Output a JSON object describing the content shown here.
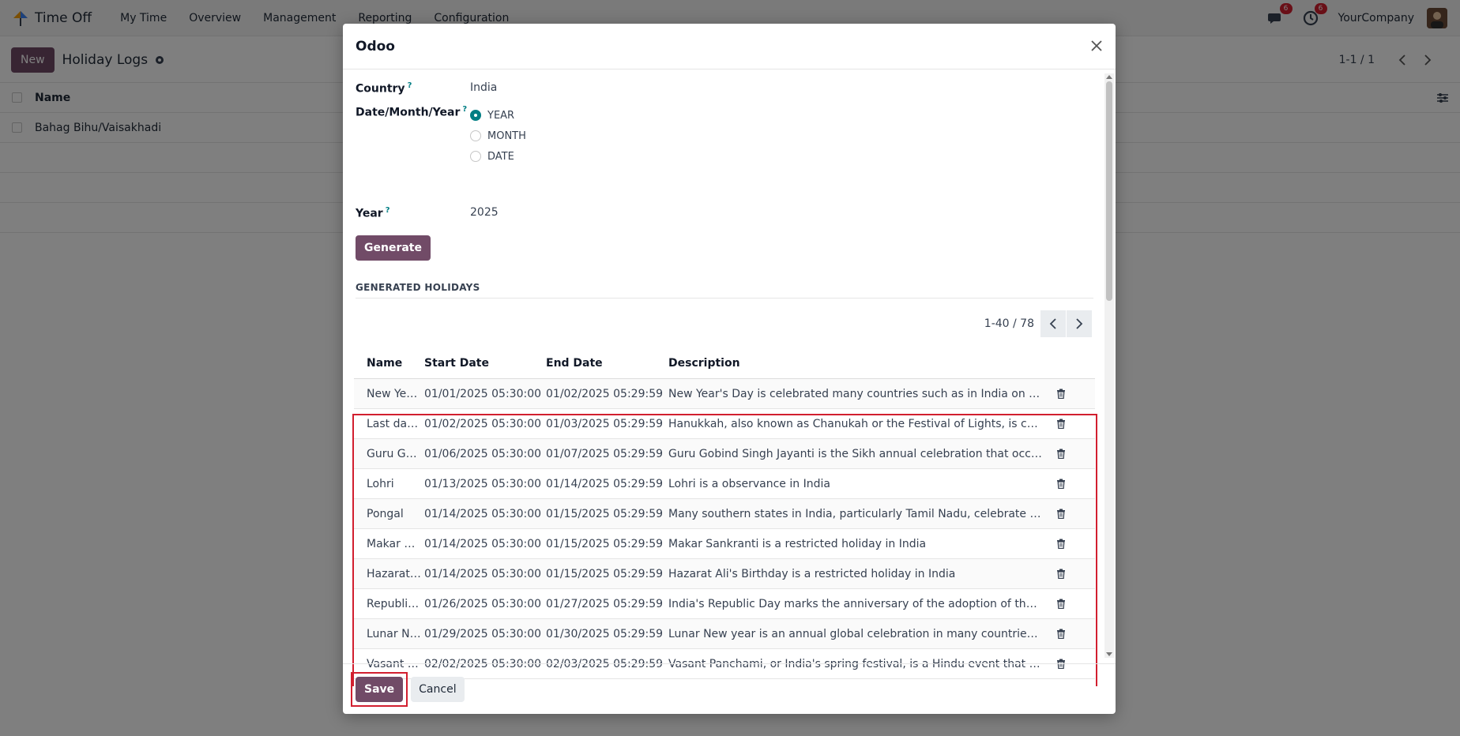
{
  "navbar": {
    "app_name": "Time Off",
    "menu": [
      "My Time",
      "Overview",
      "Management",
      "Reporting",
      "Configuration"
    ],
    "chat_badge": "6",
    "activity_badge": "6",
    "company": "YourCompany"
  },
  "control": {
    "new_label": "New",
    "title": "Holiday Logs",
    "pager": "1-1 / 1"
  },
  "list": {
    "header": "Name",
    "rows": [
      "Bahag Bihu/Vaisakhadi"
    ]
  },
  "modal": {
    "title": "Odoo",
    "country_label": "Country",
    "country_value": "India",
    "period_label": "Date/Month/Year",
    "period_options": [
      "YEAR",
      "MONTH",
      "DATE"
    ],
    "period_selected": "YEAR",
    "year_label": "Year",
    "year_value": "2025",
    "generate_label": "Generate",
    "section_title": "GENERATED HOLIDAYS",
    "pager": "1-40 / 78",
    "columns": [
      "Name",
      "Start Date",
      "End Date",
      "Description"
    ],
    "holidays": [
      {
        "name": "New Year'...",
        "start": "01/01/2025 05:30:00",
        "end": "01/02/2025 05:29:59",
        "desc": "New Year's Day is celebrated many countries such as in India on the Janua..."
      },
      {
        "name": "Last day o...",
        "start": "01/02/2025 05:30:00",
        "end": "01/03/2025 05:29:59",
        "desc": "Hanukkah, also known as Chanukah or the Festival of Lights, is celebrated..."
      },
      {
        "name": "Guru Govi...",
        "start": "01/06/2025 05:30:00",
        "end": "01/07/2025 05:29:59",
        "desc": "Guru Gobind Singh Jayanti is the Sikh annual celebration that occurs in co..."
      },
      {
        "name": "Lohri",
        "start": "01/13/2025 05:30:00",
        "end": "01/14/2025 05:29:59",
        "desc": "Lohri is a observance in India"
      },
      {
        "name": "Pongal",
        "start": "01/14/2025 05:30:00",
        "end": "01/15/2025 05:29:59",
        "desc": "Many southern states in India, particularly Tamil Nadu, celebrate Pongal a..."
      },
      {
        "name": "Makar San...",
        "start": "01/14/2025 05:30:00",
        "end": "01/15/2025 05:29:59",
        "desc": "Makar Sankranti is a restricted holiday in India"
      },
      {
        "name": "Hazarat A...",
        "start": "01/14/2025 05:30:00",
        "end": "01/15/2025 05:29:59",
        "desc": "Hazarat Ali's Birthday is a restricted holiday in India"
      },
      {
        "name": "Republic ...",
        "start": "01/26/2025 05:30:00",
        "end": "01/27/2025 05:29:59",
        "desc": "India's Republic Day marks the anniversary of the adoption of the Indian c..."
      },
      {
        "name": "Lunar Ne...",
        "start": "01/29/2025 05:30:00",
        "end": "01/30/2025 05:29:59",
        "desc": "Lunar New year is an annual global celebration in many countries includin..."
      },
      {
        "name": "Vasant Pa...",
        "start": "02/02/2025 05:30:00",
        "end": "02/03/2025 05:29:59",
        "desc": "Vasant Panchami, or India's spring festival, is a Hindu event that includes ..."
      }
    ],
    "save_label": "Save",
    "cancel_label": "Cancel"
  },
  "colors": {
    "primary": "#714b67",
    "accent": "#017e84",
    "highlight": "#d21f2f"
  }
}
